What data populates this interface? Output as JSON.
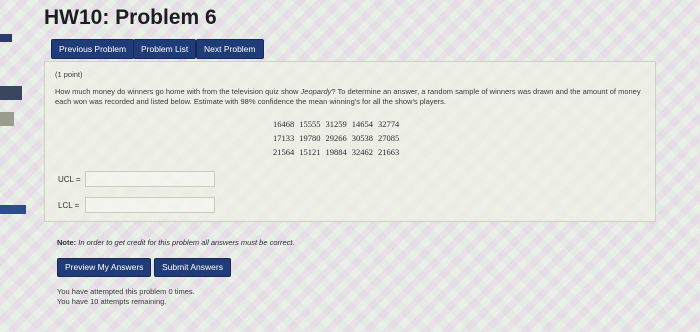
{
  "page_title": "HW10: Problem 6",
  "nav": {
    "previous_label": "Previous Problem",
    "list_label": "Problem List",
    "next_label": "Next Problem"
  },
  "problem": {
    "points": "(1 point)",
    "question_part1": "How much money do winners go home with from the television quiz show ",
    "question_show": "Jeopardy",
    "question_part2": "? To determine an answer, a random sample of winners was drawn and the amount of money each won was recorded and listed below. Estimate with 98% confidence the mean winning's for all the show's players.",
    "data_rows": [
      [
        "16468",
        "15555",
        "31259",
        "14654",
        "32774"
      ],
      [
        "17133",
        "19780",
        "29266",
        "30538",
        "27085"
      ],
      [
        "21564",
        "15121",
        "19884",
        "32462",
        "21663"
      ]
    ],
    "ucl_label": "UCL =",
    "ucl_value": "",
    "lcl_label": "LCL =",
    "lcl_value": ""
  },
  "note": {
    "bold": "Note:",
    "text": " In order to get credit for this problem all answers must be correct."
  },
  "actions": {
    "preview_label": "Preview My Answers",
    "submit_label": "Submit Answers"
  },
  "status": {
    "attempted": "You have attempted this problem 0 times.",
    "remaining": "You have 10 attempts remaining."
  },
  "colors": {
    "button_bg": "#1f3c78",
    "title": "#1d1d22"
  }
}
